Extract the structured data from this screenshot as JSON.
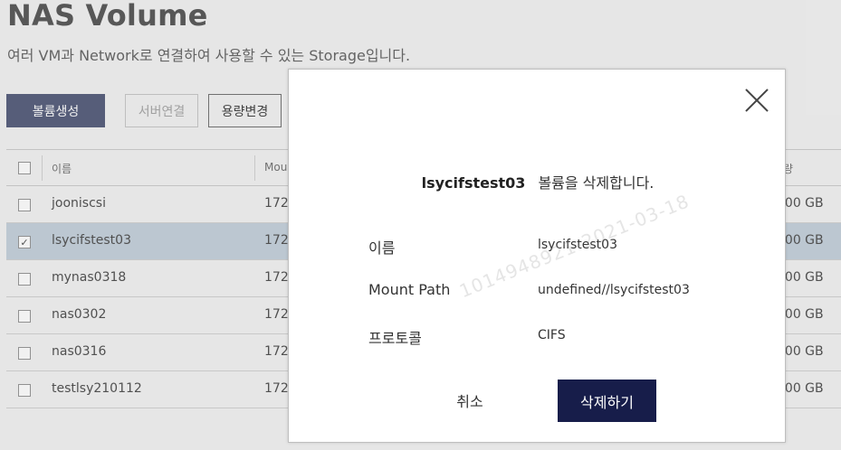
{
  "page": {
    "title": "NAS Volume",
    "description": "여러 VM과 Network로 연결하여 사용할 수 있는 Storage입니다."
  },
  "toolbar": {
    "create_label": "볼륨생성",
    "connect_label": "서버연결",
    "resize_label": "용량변경"
  },
  "table": {
    "columns": {
      "name": "이름",
      "mount": "Mou",
      "size": "량"
    },
    "rows": [
      {
        "name": "jooniscsi",
        "mount": "172",
        "size": "000 GB",
        "selected": false
      },
      {
        "name": "lsycifstest03",
        "mount": "172",
        "size": "000 GB",
        "selected": true
      },
      {
        "name": "mynas0318",
        "mount": "172",
        "size": "000 GB",
        "selected": false
      },
      {
        "name": "nas0302",
        "mount": "172",
        "size": "000 GB",
        "selected": false
      },
      {
        "name": "nas0316",
        "mount": "172",
        "size": "000 GB",
        "selected": false
      },
      {
        "name": "testlsy210112",
        "mount": "172",
        "size": "000 GB",
        "selected": false
      }
    ],
    "check_mark": "✓"
  },
  "modal": {
    "volume_name": "lsycifstest03",
    "message": "볼륨을 삭제합니다.",
    "fields": [
      {
        "label": "이름",
        "value": "lsycifstest03"
      },
      {
        "label": "Mount Path",
        "value": "undefined//lsycifstest03"
      },
      {
        "label": "프로토콜",
        "value": "CIFS"
      }
    ],
    "watermark": "1014948921-2021-03-18",
    "cancel_label": "취소",
    "confirm_label": "삭제하기"
  },
  "colors": {
    "primary_button": "#5c6380",
    "confirm_button": "#171d4a",
    "selected_row": "#c7d3de"
  }
}
